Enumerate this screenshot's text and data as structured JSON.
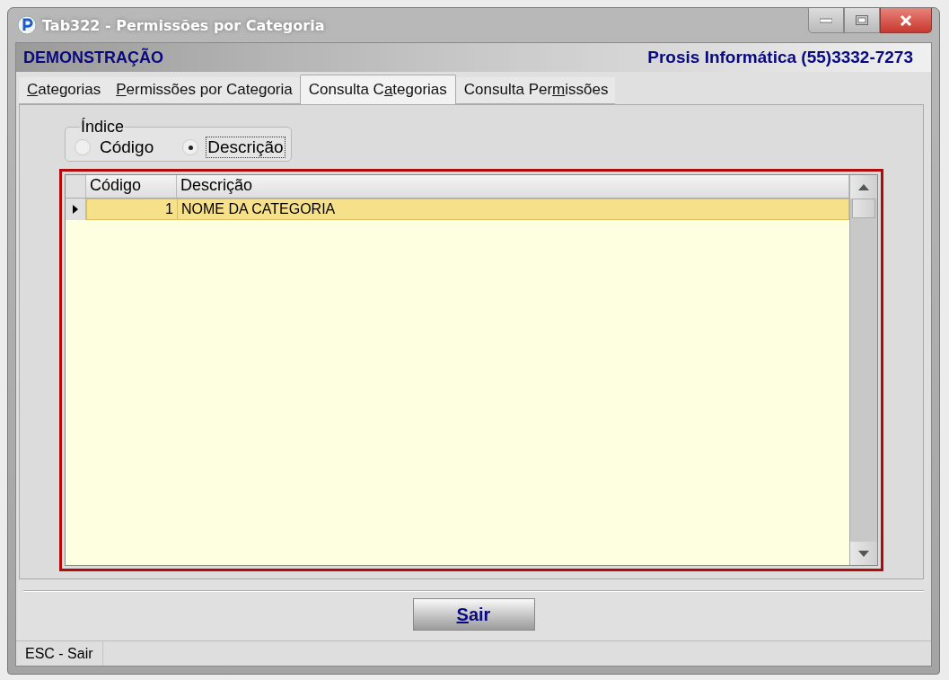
{
  "window": {
    "title": "Tab322 - Permissões por Categoria"
  },
  "header": {
    "left": "DEMONSTRAÇÃO",
    "right": "Prosis Informática (55)3332-7273"
  },
  "tabs": [
    {
      "key": "C",
      "post": "ategorias",
      "selected": false
    },
    {
      "key": "P",
      "post": "ermissões por Categoria",
      "selected": false
    },
    {
      "pre": "Consulta C",
      "key": "a",
      "post": "tegorias",
      "selected": true
    },
    {
      "pre": "Consulta Per",
      "key": "m",
      "post": "issões",
      "selected": false
    }
  ],
  "index_group": {
    "title": "Índice",
    "options": [
      {
        "label": "Código",
        "selected": false
      },
      {
        "label": "Descrição",
        "selected": true
      }
    ]
  },
  "grid": {
    "columns": [
      "Código",
      "Descrição"
    ],
    "rows": [
      {
        "codigo": "1",
        "descricao": "NOME DA CATEGORIA",
        "selected": true
      }
    ]
  },
  "exit_button": {
    "key": "S",
    "post": "air"
  },
  "status_bar": {
    "text": "ESC - Sair"
  }
}
